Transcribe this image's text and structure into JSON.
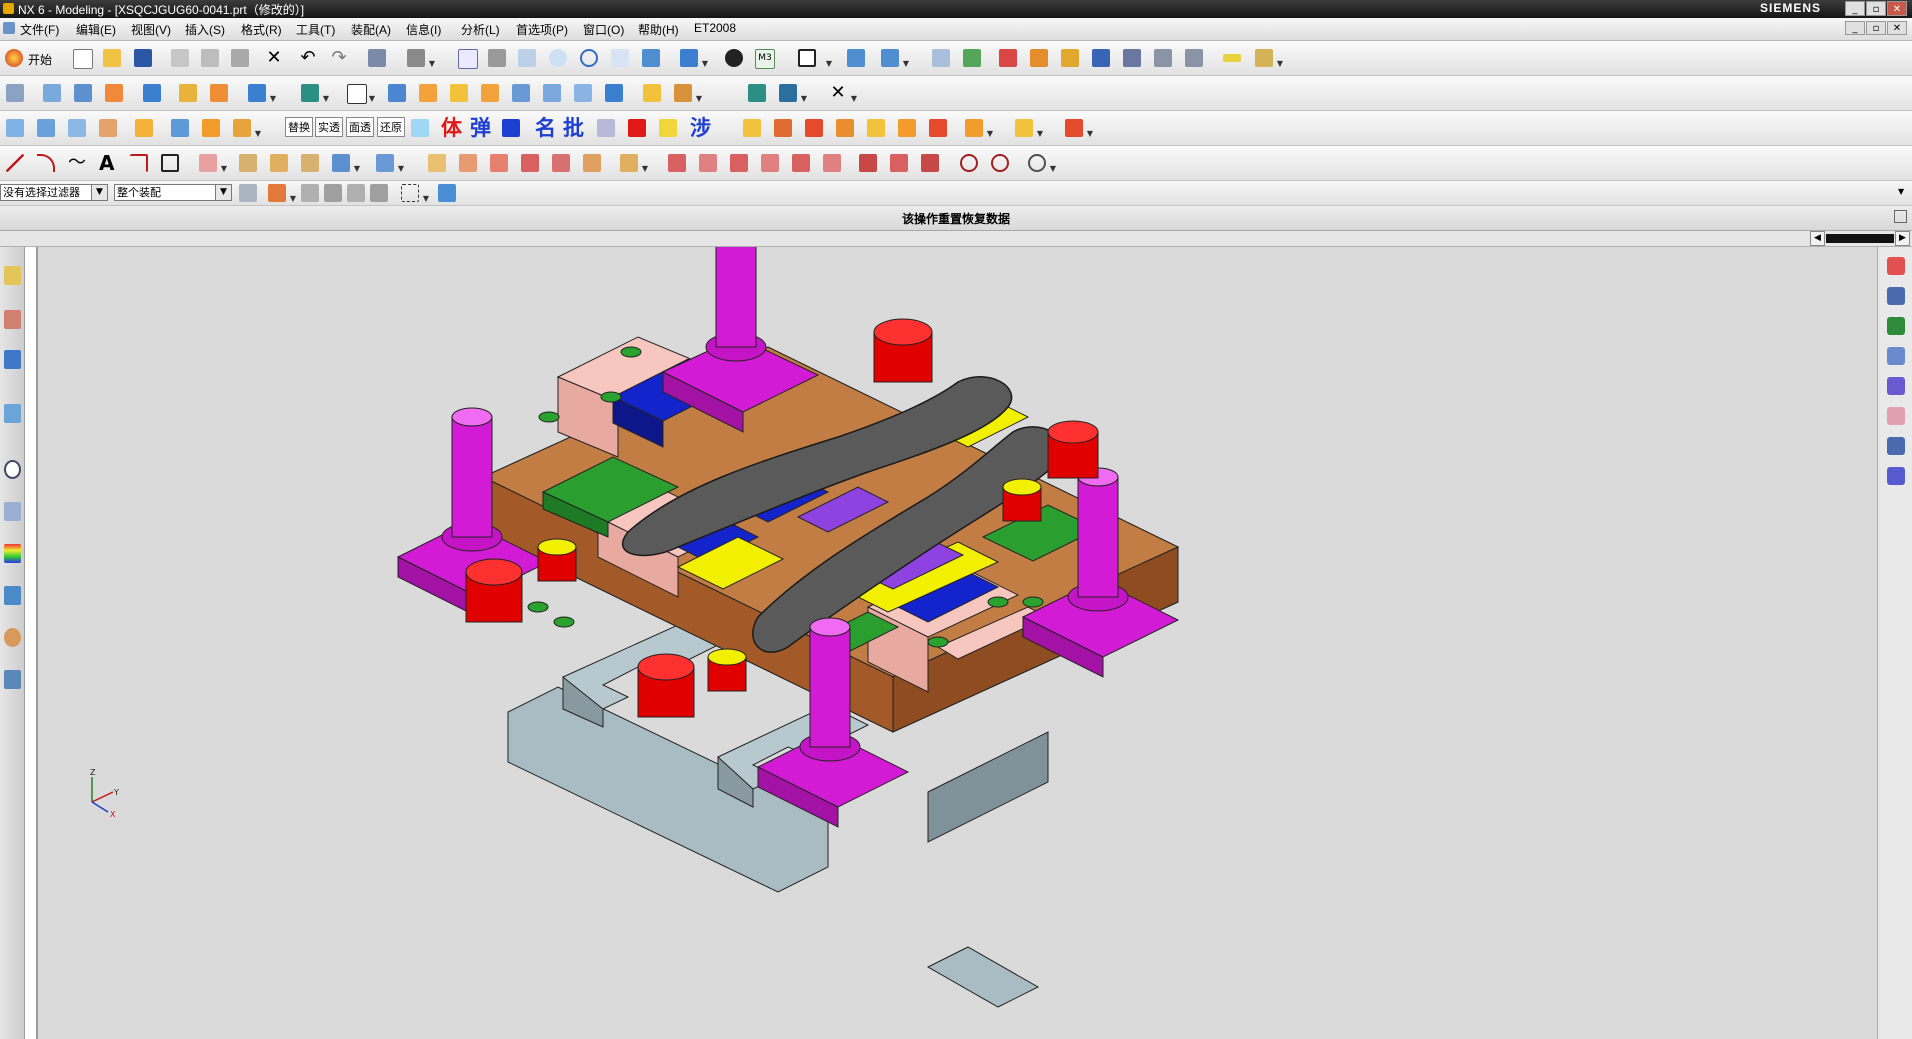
{
  "window": {
    "title": "NX 6 - Modeling - [XSQCJGUG60-0041.prt（修改的）]",
    "brand": "SIEMENS",
    "controls": [
      "_",
      "▫",
      "✕"
    ],
    "doc_controls": [
      "_",
      "▫",
      "✕"
    ]
  },
  "menu": {
    "items": [
      "文件(F)",
      "编辑(E)",
      "视图(V)",
      "插入(S)",
      "格式(R)",
      "工具(T)",
      "装配(A)",
      "信息(I)",
      "分析(L)",
      "首选项(P)",
      "窗口(O)",
      "帮助(H)",
      "ET2008"
    ]
  },
  "toolbar1": {
    "start_label": "开始"
  },
  "toolbar1_text": {
    "layer_label": "M3"
  },
  "toolbar3": {
    "text_buttons": [
      "替换",
      "实透",
      "面透",
      "还原"
    ],
    "big_chars": [
      "体",
      "弹",
      "名",
      "批"
    ]
  },
  "filters": {
    "selection_filter": "没有选择过滤器",
    "scope": "整个装配"
  },
  "cue": {
    "text": "该操作重置恢复数据"
  },
  "icons": {
    "left_resource_bar": [
      "assembly-navigator-icon",
      "part-navigator-icon",
      "constraint-navigator-icon",
      "roles-icon",
      "history-icon",
      "reuse-library-icon",
      "palette-icon",
      "process-studio-icon",
      "user-roles-icon",
      "system-visualization-icon"
    ],
    "right_resource_bar": [
      "mold-wizard-icon",
      "t-tool-icon",
      "green-tool-icon",
      "stack-tool-icon",
      "tri-icon",
      "clamp-icon",
      "pin-icon",
      "thumb-icon"
    ]
  },
  "colors": {
    "magenta": "#d31bd5",
    "red": "#e10000",
    "brown": "#b9733d",
    "pink": "#f5c0b9",
    "blue": "#1320c9",
    "green": "#29a22e",
    "yellow": "#f2f000",
    "purple": "#8e43e1",
    "steel": "#a7b8bf",
    "gray_part": "#595959"
  }
}
